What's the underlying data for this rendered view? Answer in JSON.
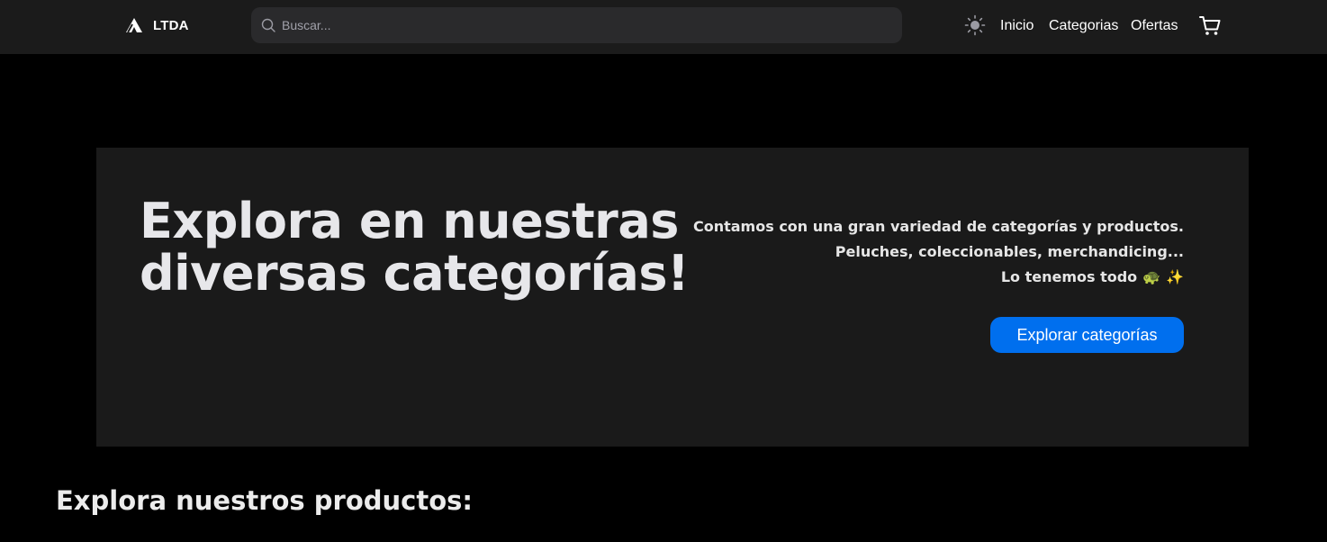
{
  "navbar": {
    "brand": {
      "name": "LTDA",
      "icon": "ltda-logo-icon"
    },
    "search": {
      "placeholder": "Buscar...",
      "value": "",
      "icon": "search-icon"
    },
    "theme_toggle_icon": "sun-icon",
    "links": [
      {
        "label": "Inicio"
      },
      {
        "label": "Categorias"
      },
      {
        "label": "Ofertas"
      }
    ],
    "cart_icon": "cart-icon"
  },
  "hero": {
    "title": "Explora en nuestras diversas categorías!",
    "lines": [
      "Contamos con una gran variedad de categorías y productos.",
      "Peluches, coleccionables, merchandicing...",
      "Lo tenemos todo"
    ],
    "emojis": [
      "🐢",
      "✨"
    ],
    "button_label": "Explorar categorías"
  },
  "products": {
    "title": "Explora nuestros productos:"
  },
  "colors": {
    "background": "#000000",
    "navbar": "#1b1b1b",
    "hero": "#1a1a1a",
    "accent": "#006fee",
    "text": "#ececec"
  }
}
